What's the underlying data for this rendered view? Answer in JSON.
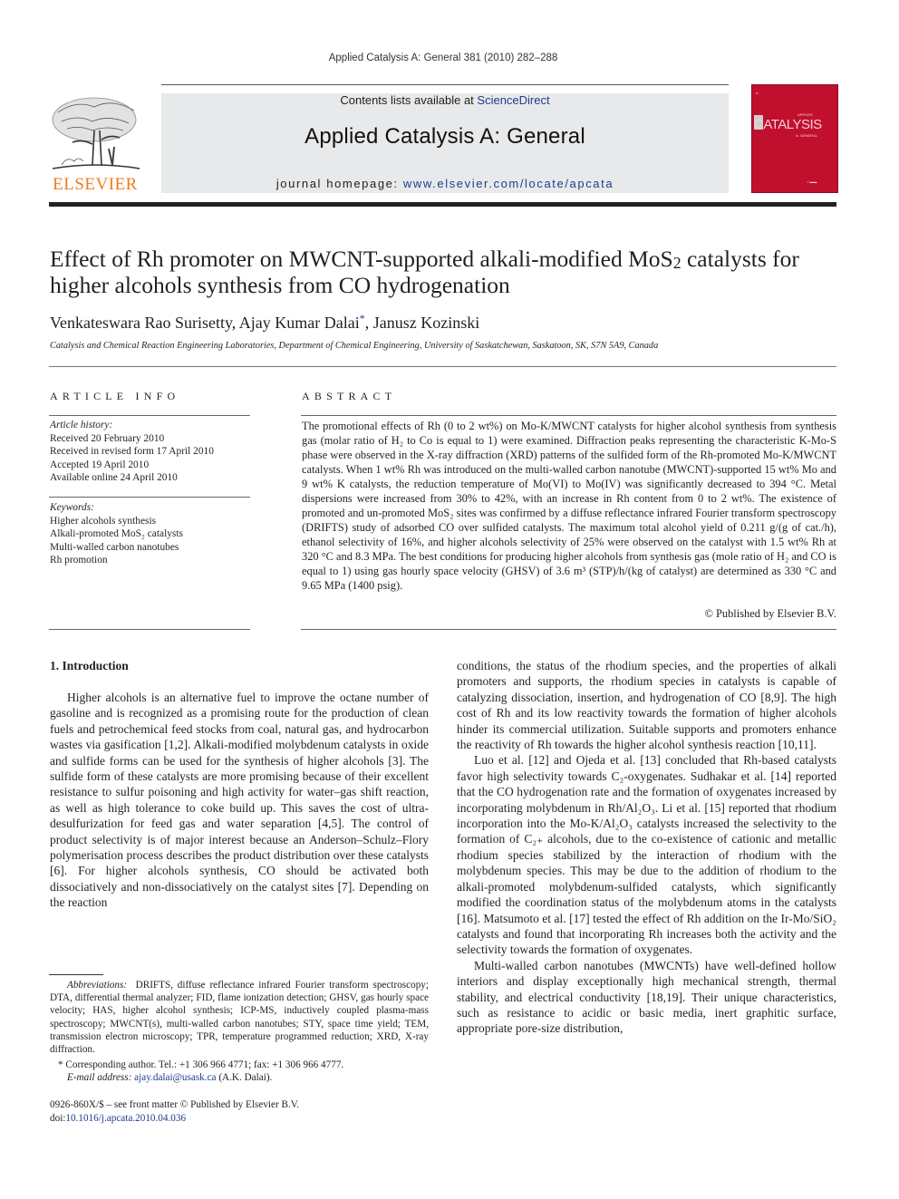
{
  "header": {
    "citation": "Applied Catalysis A: General 381 (2010) 282–288",
    "contents_prefix": "Contents lists available at ",
    "contents_link": "ScienceDirect",
    "journal_title": "Applied Catalysis A: General",
    "homepage_prefix": "journal homepage: ",
    "homepage_link": "www.elsevier.com/locate/apcata",
    "publisher_logo": "ELSEVIER",
    "cover_title": "CATALYSIS",
    "cover_top": "APPLIED",
    "cover_sub": "A: GENERAL",
    "colors": {
      "brand_orange": "#f07b1b",
      "cover_red": "#c0102d",
      "link_blue": "#1e3c8c"
    }
  },
  "article": {
    "title_part1": "Effect of Rh promoter on MWCNT-supported alkali-modified MoS",
    "title_sub": "2",
    "title_part2": " catalysts for higher alcohols synthesis from CO hydrogenation",
    "authors": [
      {
        "name": "Venkateswara Rao Surisetty",
        "sep": ", "
      },
      {
        "name": "Ajay Kumar Dalai",
        "mark": "*",
        "sep": ", "
      },
      {
        "name": "Janusz Kozinski",
        "sep": ""
      }
    ],
    "affiliation": "Catalysis and Chemical Reaction Engineering Laboratories, Department of Chemical Engineering, University of Saskatchewan, Saskatoon, SK, S7N 5A9, Canada"
  },
  "article_info": {
    "heading": "ARTICLE INFO",
    "history_label": "Article history:",
    "history": [
      "Received 20 February 2010",
      "Received in revised form 17 April 2010",
      "Accepted 19 April 2010",
      "Available online 24 April 2010"
    ],
    "keywords_label": "Keywords:",
    "keywords": [
      "Higher alcohols synthesis",
      "Alkali-promoted MoS₂ catalysts",
      "Multi-walled carbon nanotubes",
      "Rh promotion"
    ]
  },
  "abstract": {
    "heading": "ABSTRACT",
    "text": "The promotional effects of Rh (0 to 2 wt%) on Mo-K/MWCNT catalysts for higher alcohol synthesis from synthesis gas (molar ratio of H₂ to Co is equal to 1) were examined. Diffraction peaks representing the characteristic K-Mo-S phase were observed in the X-ray diffraction (XRD) patterns of the sulfided form of the Rh-promoted Mo-K/MWCNT catalysts. When 1 wt% Rh was introduced on the multi-walled carbon nanotube (MWCNT)-supported 15 wt% Mo and 9 wt% K catalysts, the reduction temperature of Mo(VI) to Mo(IV) was significantly decreased to 394 °C. Metal dispersions were increased from 30% to 42%, with an increase in Rh content from 0 to 2 wt%. The existence of promoted and un-promoted MoS₂ sites was confirmed by a diffuse reflectance infrared Fourier transform spectroscopy (DRIFTS) study of adsorbed CO over sulfided catalysts. The maximum total alcohol yield of 0.211 g/(g of cat./h), ethanol selectivity of 16%, and higher alcohols selectivity of 25% were observed on the catalyst with 1.5 wt% Rh at 320 °C and 8.3 MPa. The best conditions for producing higher alcohols from synthesis gas (mole ratio of H₂ and CO is equal to 1) using gas hourly space velocity (GHSV) of 3.6 m³ (STP)/h/(kg of catalyst) are determined as 330 °C and 9.65 MPa (1400 psig).",
    "copyright": "© Published by Elsevier B.V."
  },
  "body": {
    "section_heading": "1.  Introduction",
    "left_paragraph": "Higher alcohols is an alternative fuel to improve the octane number of gasoline and is recognized as a promising route for the production of clean fuels and petrochemical feed stocks from coal, natural gas, and hydrocarbon wastes via gasification [1,2]. Alkali-modified molybdenum catalysts in oxide and sulfide forms can be used for the synthesis of higher alcohols [3]. The sulfide form of these catalysts are more promising because of their excellent resistance to sulfur poisoning and high activity for water–gas shift reaction, as well as high tolerance to coke build up. This saves the cost of ultra-desulfurization for feed gas and water separation [4,5]. The control of product selectivity is of major interest because an Anderson–Schulz–Flory polymerisation process describes the product distribution over these catalysts [6]. For higher alcohols synthesis, CO should be activated both dissociatively and non-dissociatively on the catalyst sites [7]. Depending on the reaction",
    "right_paragraphs": [
      "conditions, the status of the rhodium species, and the properties of alkali promoters and supports, the rhodium species in catalysts is capable of catalyzing dissociation, insertion, and hydrogenation of CO [8,9]. The high cost of Rh and its low reactivity towards the formation of higher alcohols hinder its commercial utilization. Suitable supports and promoters enhance the reactivity of Rh towards the higher alcohol synthesis reaction [10,11].",
      "Luo et al. [12] and Ojeda et al. [13] concluded that Rh-based catalysts favor high selectivity towards C₂-oxygenates. Sudhakar et al. [14] reported that the CO hydrogenation rate and the formation of oxygenates increased by incorporating molybdenum in Rh/Al₂O₃. Li et al. [15] reported that rhodium incorporation into the Mo-K/Al₂O₃ catalysts increased the selectivity to the formation of C₂₊ alcohols, due to the co-existence of cationic and metallic rhodium species stabilized by the interaction of rhodium with the molybdenum species. This may be due to the addition of rhodium to the alkali-promoted molybdenum-sulfided catalysts, which significantly modified the coordination status of the molybdenum atoms in the catalysts [16]. Matsumoto et al. [17] tested the effect of Rh addition on the Ir-Mo/SiO₂ catalysts and found that incorporating Rh increases both the activity and the selectivity towards the formation of oxygenates.",
      "Multi-walled carbon nanotubes (MWCNTs) have well-defined hollow interiors and display exceptionally high mechanical strength, thermal stability, and electrical conductivity [18,19]. Their unique characteristics, such as resistance to acidic or basic media, inert graphitic surface, appropriate pore-size distribution,"
    ]
  },
  "footnotes": {
    "abbrev_label": "Abbreviations:",
    "abbrev_text": "DRIFTS, diffuse reflectance infrared Fourier transform spectroscopy; DTA, differential thermal analyzer; FID, flame ionization detection; GHSV, gas hourly space velocity; HAS, higher alcohol synthesis; ICP-MS, inductively coupled plasma-mass spectroscopy; MWCNT(s), multi-walled carbon nanotubes; STY, space time yield; TEM, transmission electron microscopy; TPR, temperature programmed reduction; XRD, X-ray diffraction.",
    "corresponding": "* Corresponding author. Tel.: +1 306 966 4771; fax: +1 306 966 4777.",
    "email_label": "E-mail address:",
    "email": "ajay.dalai@usask.ca",
    "email_suffix": " (A.K. Dalai)."
  },
  "front_matter": {
    "issn_line": "0926-860X/$ – see front matter © Published by Elsevier B.V.",
    "doi_prefix": "doi:",
    "doi": "10.1016/j.apcata.2010.04.036"
  }
}
